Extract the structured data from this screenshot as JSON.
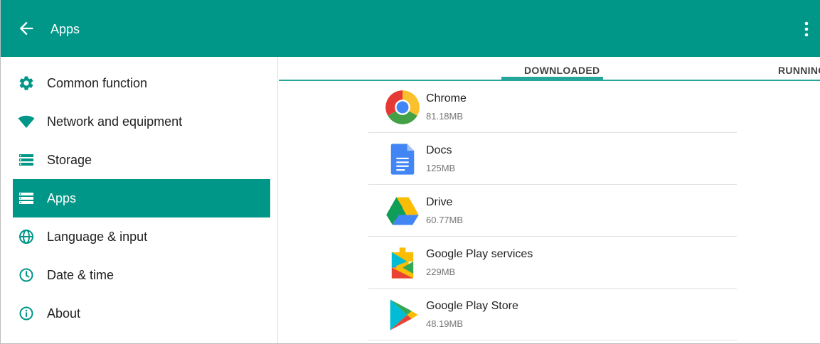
{
  "colors": {
    "accent": "#009688",
    "tab_indicator": "#26a69a"
  },
  "appbar": {
    "title": "Apps",
    "back_icon": "arrow-back-icon",
    "menu_icon": "more-vert-icon"
  },
  "sidebar": {
    "items": [
      {
        "label": "Common function",
        "icon": "gear-icon",
        "active": false
      },
      {
        "label": "Network and equipment",
        "icon": "wifi-icon",
        "active": false
      },
      {
        "label": "Storage",
        "icon": "storage-icon",
        "active": false
      },
      {
        "label": "Apps",
        "icon": "apps-icon",
        "active": true
      },
      {
        "label": "Language & input",
        "icon": "globe-icon",
        "active": false
      },
      {
        "label": "Date & time",
        "icon": "clock-icon",
        "active": false
      },
      {
        "label": "About",
        "icon": "info-icon",
        "active": false
      }
    ]
  },
  "tabs": [
    {
      "label": "DOWNLOADED",
      "selected": true
    },
    {
      "label": "RUNNING",
      "selected": false
    }
  ],
  "apps": [
    {
      "name": "Chrome",
      "size": "81.18MB",
      "icon": "chrome-icon"
    },
    {
      "name": "Docs",
      "size": "125MB",
      "icon": "docs-icon"
    },
    {
      "name": "Drive",
      "size": "60.77MB",
      "icon": "drive-icon"
    },
    {
      "name": "Google Play services",
      "size": "229MB",
      "icon": "play-services-icon"
    },
    {
      "name": "Google Play Store",
      "size": "48.19MB",
      "icon": "play-store-icon"
    }
  ]
}
